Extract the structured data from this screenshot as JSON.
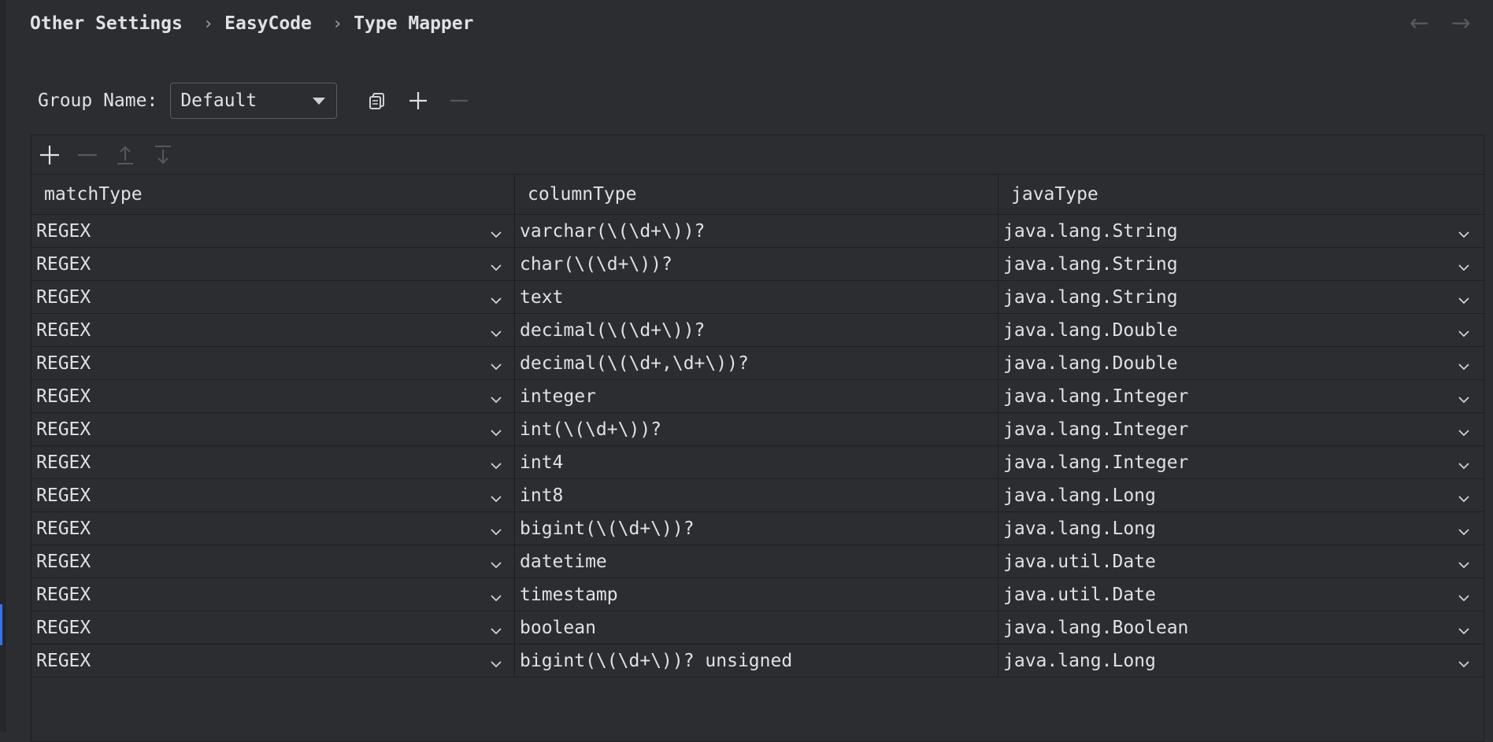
{
  "breadcrumb": {
    "items": [
      "Other Settings",
      "EasyCode",
      "Type Mapper"
    ],
    "separator": "›"
  },
  "nav": {
    "back_icon": "arrow-left-icon",
    "forward_icon": "arrow-right-icon",
    "back_glyph": "←",
    "forward_glyph": "→"
  },
  "group": {
    "label": "Group Name:",
    "selected": "Default"
  },
  "table": {
    "columns": [
      "matchType",
      "columnType",
      "javaType"
    ],
    "rows": [
      [
        "REGEX",
        "varchar(\\(\\d+\\))?",
        "java.lang.String"
      ],
      [
        "REGEX",
        "char(\\(\\d+\\))?",
        "java.lang.String"
      ],
      [
        "REGEX",
        "text",
        "java.lang.String"
      ],
      [
        "REGEX",
        "decimal(\\(\\d+\\))?",
        "java.lang.Double"
      ],
      [
        "REGEX",
        "decimal(\\(\\d+,\\d+\\))?",
        "java.lang.Double"
      ],
      [
        "REGEX",
        "integer",
        "java.lang.Integer"
      ],
      [
        "REGEX",
        "int(\\(\\d+\\))?",
        "java.lang.Integer"
      ],
      [
        "REGEX",
        "int4",
        "java.lang.Integer"
      ],
      [
        "REGEX",
        "int8",
        "java.lang.Long"
      ],
      [
        "REGEX",
        "bigint(\\(\\d+\\))?",
        "java.lang.Long"
      ],
      [
        "REGEX",
        "datetime",
        "java.util.Date"
      ],
      [
        "REGEX",
        "timestamp",
        "java.util.Date"
      ],
      [
        "REGEX",
        "boolean",
        "java.lang.Boolean"
      ],
      [
        "REGEX",
        "bigint(\\(\\d+\\))? unsigned",
        "java.lang.Long"
      ]
    ]
  },
  "colors": {
    "background": "#2b2d30",
    "border": "#1e1f22",
    "text": "#dfe1e5",
    "muted_icon": "#55585e",
    "accent": "#3574f0"
  }
}
